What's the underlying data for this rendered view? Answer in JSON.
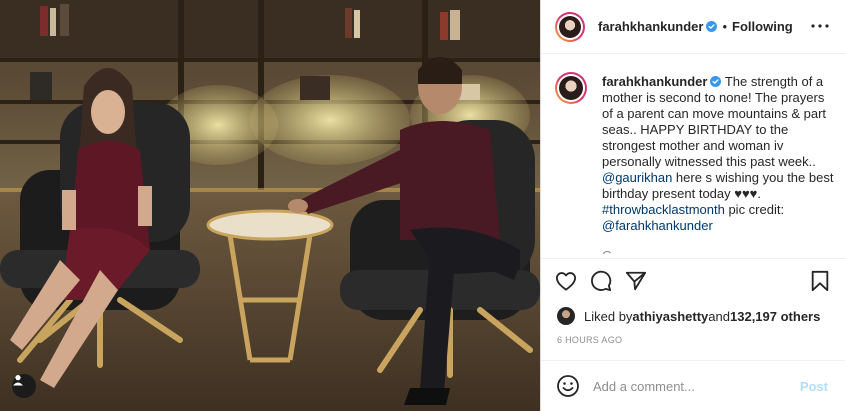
{
  "photo": {
    "alt": "Gauri Khan and Shah Rukh Khan seated in leather lounge chairs",
    "tag_icon": "user-silhouette-icon"
  },
  "header": {
    "username": "farahkhankunder",
    "separator": "•",
    "follow_status": "Following",
    "verified_icon": "verified-badge-icon",
    "more_icon": "ellipsis-icon"
  },
  "caption": {
    "username": "farahkhankunder",
    "text_1": " The strength of a mother is second to none! The prayers of a parent can move mountains & part seas.. HAPPY BIRTHDAY to the strongest mother and woman iv personally witnessed this past week.. ",
    "mention_1": "@gaurikhan",
    "text_2": " here s wishing you the best birthday present today ♥♥♥.",
    "hashtag": "#throwbacklastmonth",
    "text_3": " pic credit: ",
    "mention_2": "@farahkhankunder",
    "next_line_partial": "G..."
  },
  "actions": {
    "like_icon": "heart-icon",
    "comment_icon": "comment-bubble-icon",
    "share_icon": "paper-plane-icon",
    "save_icon": "bookmark-icon"
  },
  "likes": {
    "prefix": "Liked by ",
    "user": "athiyashetty",
    "middle": " and ",
    "count": "132,197 others"
  },
  "timestamp": "6 HOURS AGO",
  "comment": {
    "placeholder": "Add a comment...",
    "post_label": "Post",
    "emoji_icon": "smiley-face-icon"
  },
  "colors": {
    "text": "#262626",
    "secondary": "#8e8e8e",
    "link": "#00376b",
    "verified": "#3897f0",
    "post_disabled": "#b2dffc",
    "divider": "#efefef"
  }
}
